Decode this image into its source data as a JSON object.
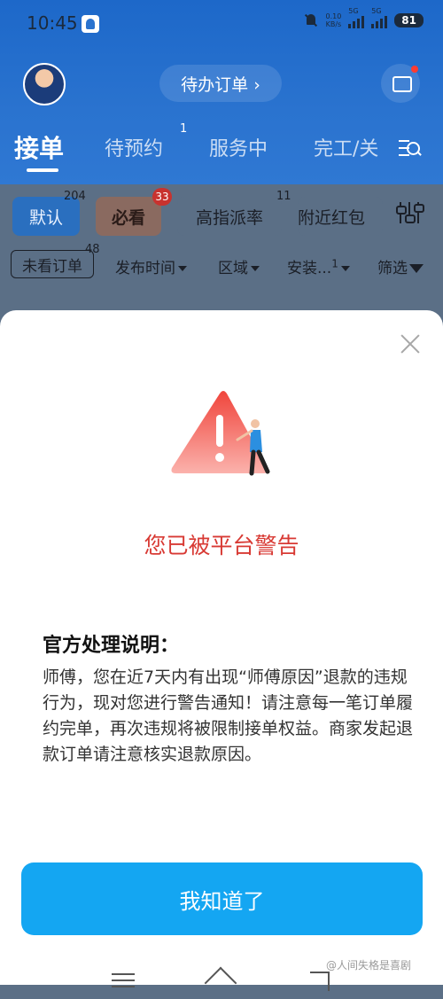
{
  "status_bar": {
    "time": "10:45",
    "net_speed_value": "0.10",
    "net_speed_unit": "KB/s",
    "signal_1": "5G",
    "signal_2": "5G",
    "battery": "81"
  },
  "header": {
    "pending_orders_label": "待办订单 ›"
  },
  "tabs": {
    "items": [
      {
        "label": "接单"
      },
      {
        "label": "待预约",
        "badge": "1"
      },
      {
        "label": "服务中"
      },
      {
        "label": "完工/关"
      }
    ]
  },
  "filters": {
    "chips": [
      {
        "label": "默认",
        "badge": "204"
      },
      {
        "label": "必看",
        "badge": "33"
      },
      {
        "label": "高指派率",
        "badge": "11"
      },
      {
        "label": "附近红包"
      }
    ],
    "sub": {
      "unread": "未看订单",
      "unread_badge": "48",
      "publish_time": "发布时间",
      "region": "区域",
      "install": "安装...",
      "install_badge": "1",
      "filter": "筛选"
    }
  },
  "dialog": {
    "title": "您已被平台警告",
    "section_heading": "官方处理说明：",
    "body": "师傅，您在近7天内有出现“师傅原因”退款的违规行为，现对您进行警告通知！请注意每一笔订单履约完单，再次违规将被限制接单权益。商家发起退款订单请注意核实退款原因。",
    "confirm_label": "我知道了",
    "accent_color": "#d83a34",
    "button_color": "#14a6f2"
  },
  "watermark": "@人间失格是喜剧"
}
